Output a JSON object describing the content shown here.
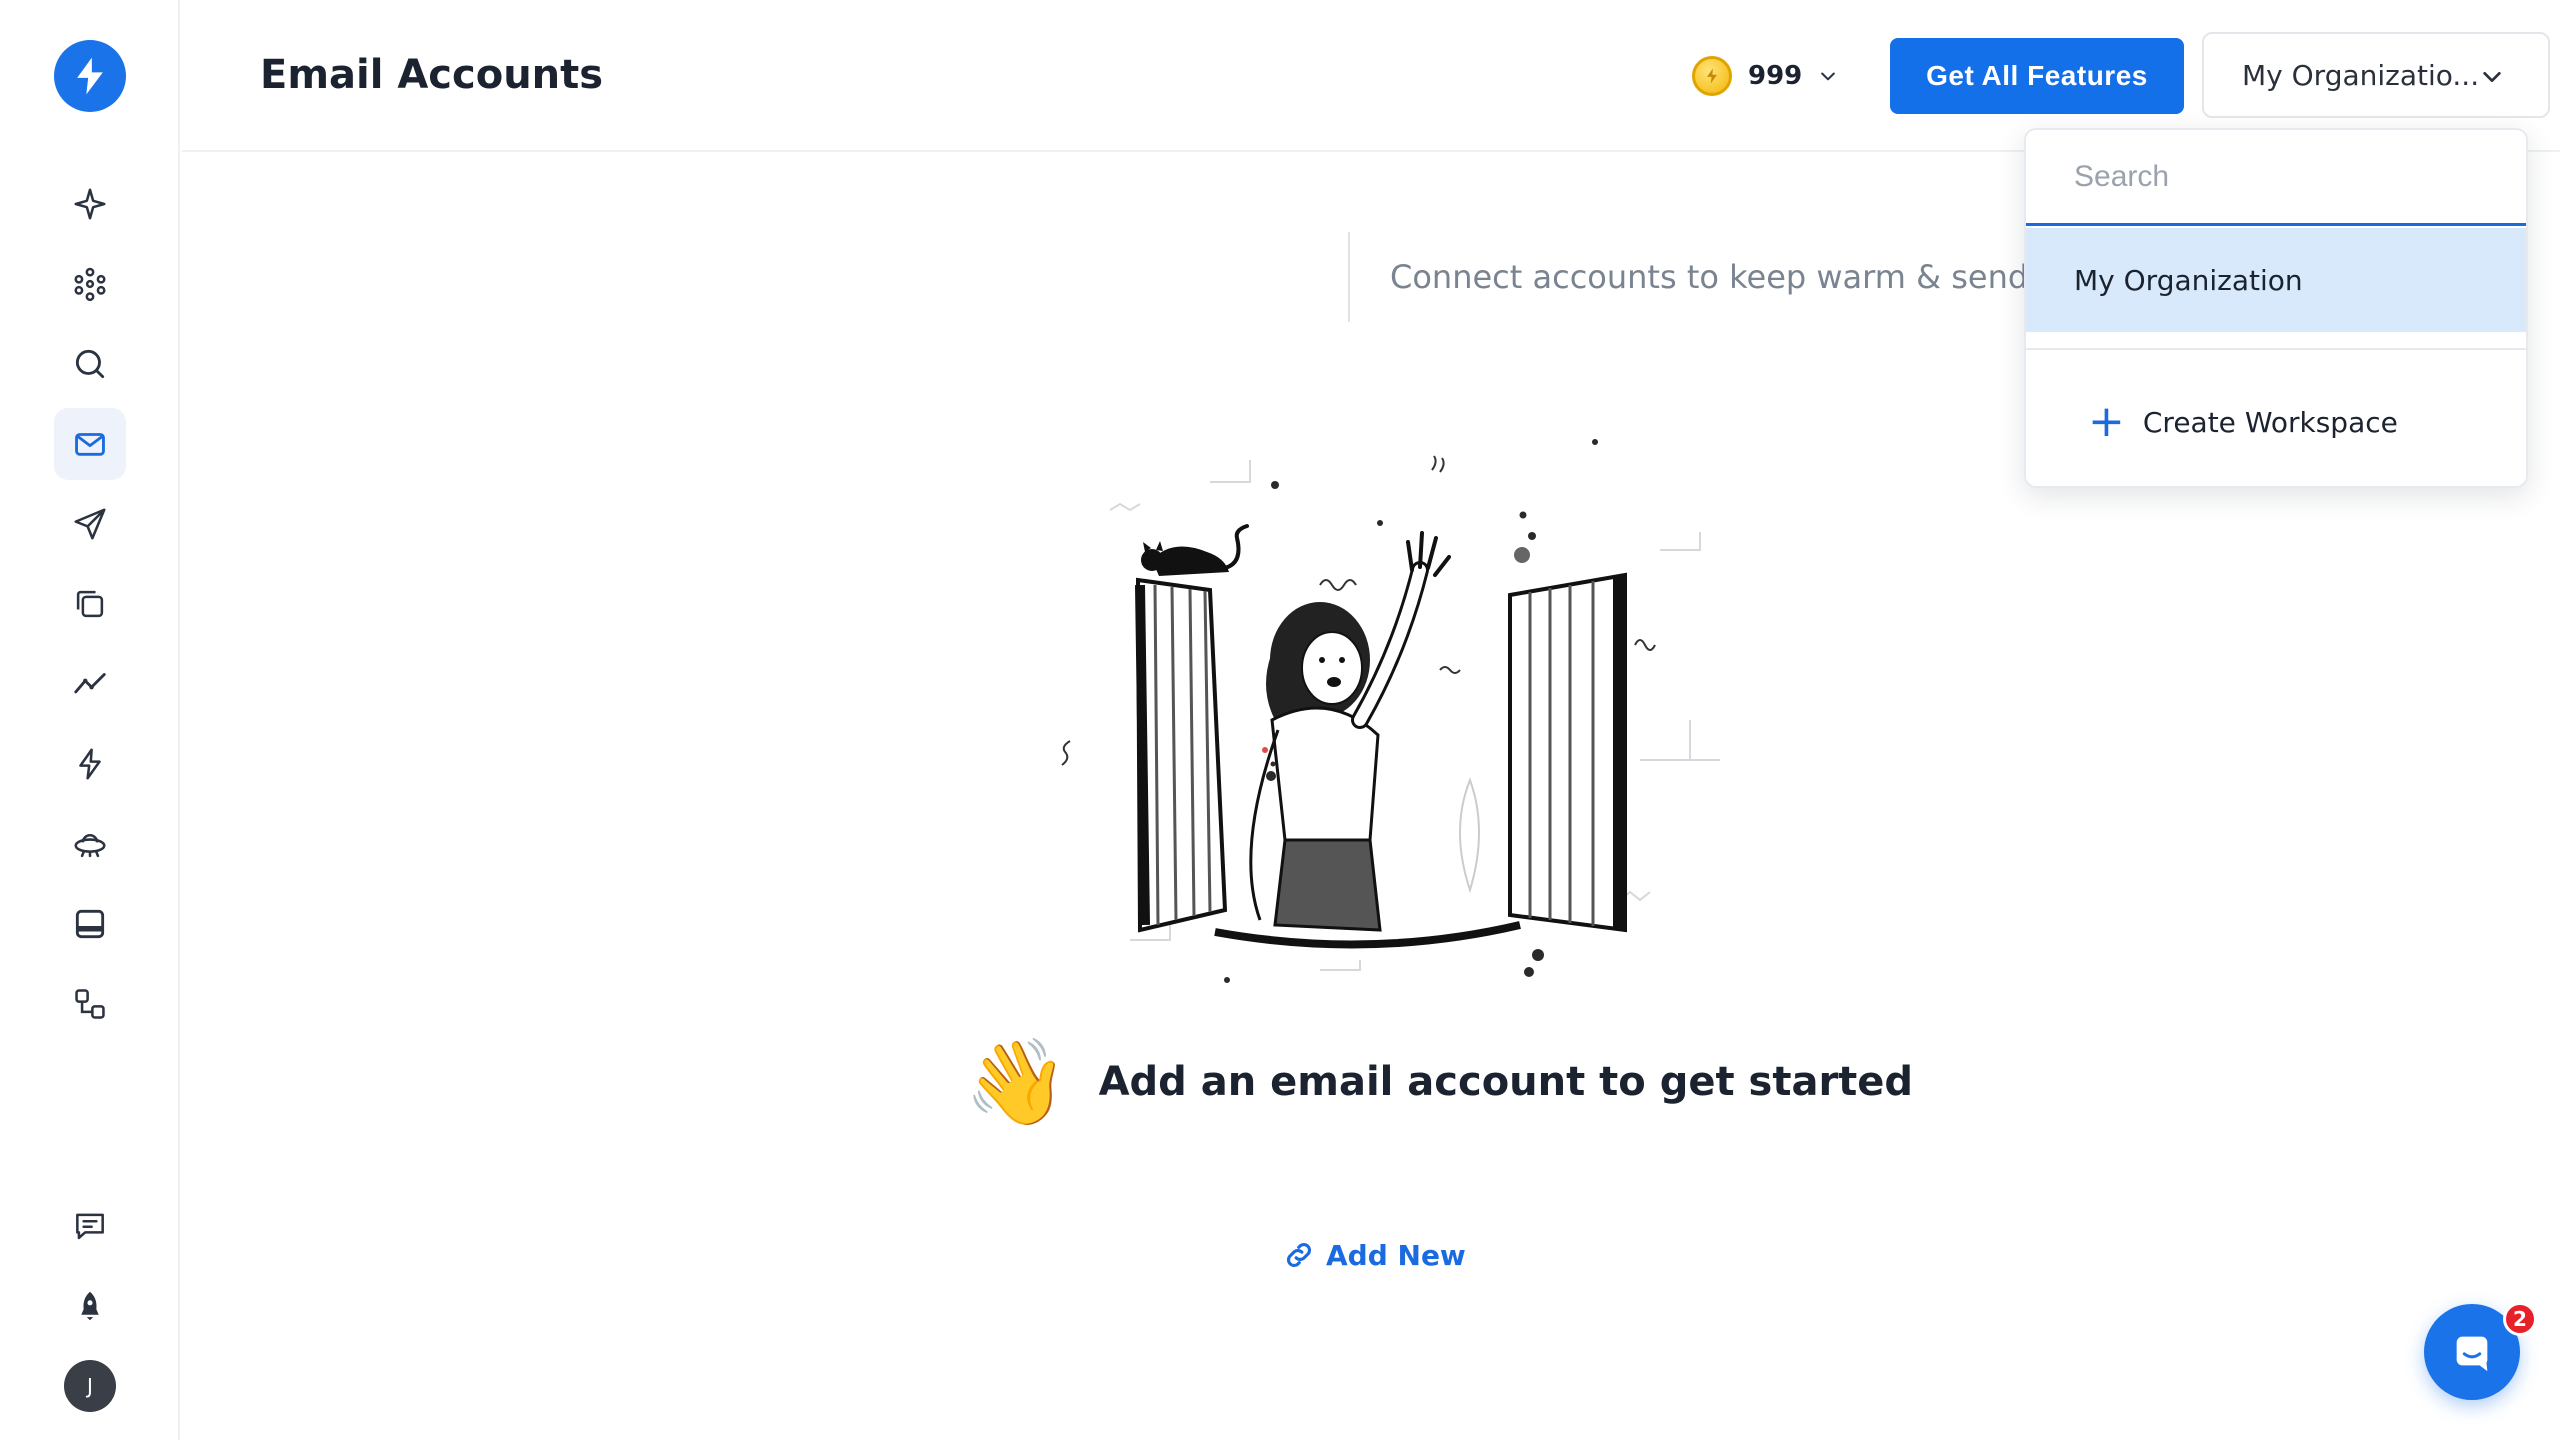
{
  "header": {
    "title": "Email Accounts",
    "credits": "999",
    "cta_label": "Get All Features",
    "org_selected": "My Organizatio..."
  },
  "dropdown": {
    "search_placeholder": "Search",
    "items": [
      {
        "label": "My Organization",
        "selected": true
      }
    ],
    "create_label": "Create Workspace"
  },
  "main": {
    "subtitle": "Connect accounts to keep warm & send em",
    "empty_text": "Add an email account to get started",
    "add_new_label": "Add New",
    "wave_emoji": "👋"
  },
  "sidebar": {
    "items": [
      {
        "icon": "sparkle-icon"
      },
      {
        "icon": "network-icon"
      },
      {
        "icon": "search-icon"
      },
      {
        "icon": "mail-icon",
        "active": true
      },
      {
        "icon": "send-icon"
      },
      {
        "icon": "copy-icon"
      },
      {
        "icon": "analytics-icon"
      },
      {
        "icon": "lightning-icon"
      },
      {
        "icon": "ufo-icon"
      },
      {
        "icon": "inbox-icon"
      },
      {
        "icon": "workflow-icon"
      }
    ],
    "bottom": [
      {
        "icon": "feedback-icon"
      },
      {
        "icon": "rocket-icon"
      }
    ],
    "avatar_initial": "J"
  },
  "chat": {
    "badge_count": "2"
  },
  "colors": {
    "accent": "#1470e8",
    "selected_bg": "#d7e9fa",
    "badge": "#e8202a"
  }
}
